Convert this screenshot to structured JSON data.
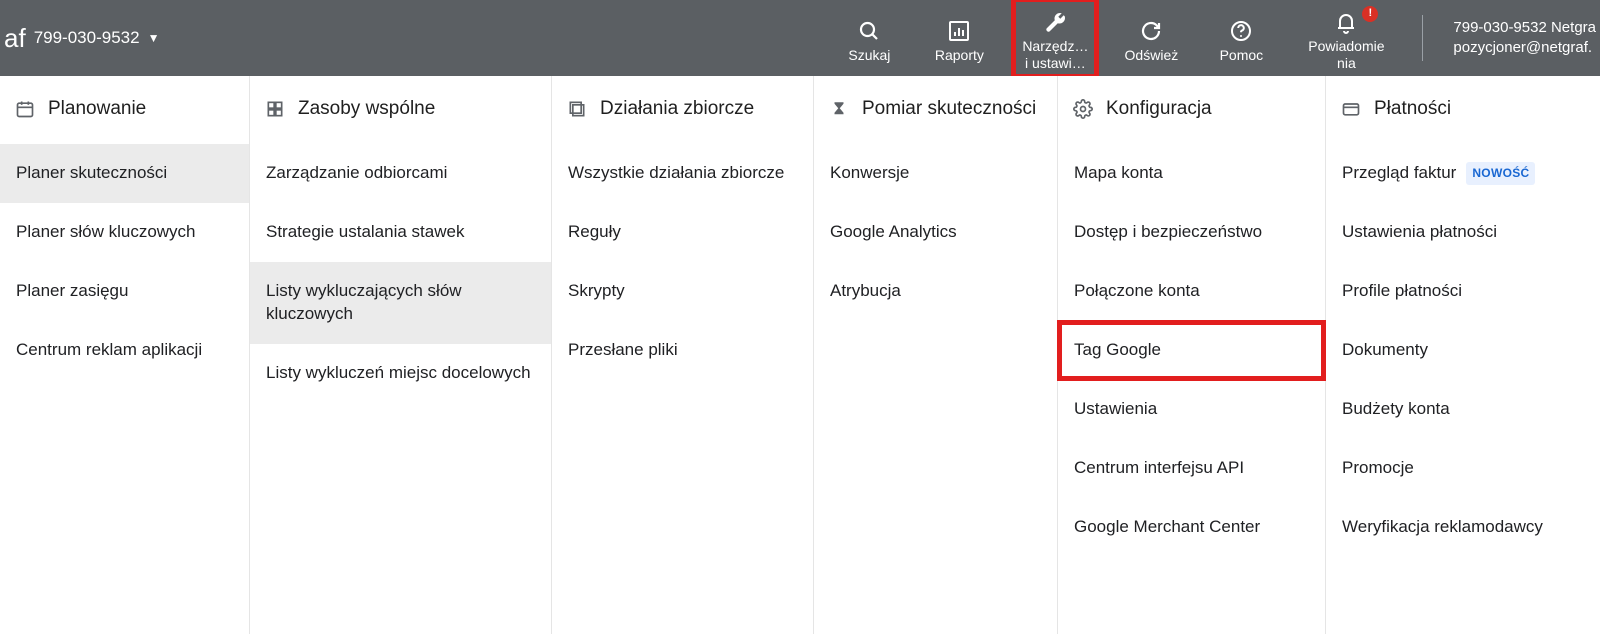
{
  "topbar": {
    "brand": "af",
    "account": "799-030-9532",
    "actions": {
      "search": "Szukaj",
      "reports": "Raporty",
      "tools_l1": "Narzędz…",
      "tools_l2": "i ustawi…",
      "refresh": "Odśwież",
      "help": "Pomoc",
      "notif_l1": "Powiadomie",
      "notif_l2": "nia",
      "notif_badge": "!"
    },
    "account_right_l1": "799-030-9532 Netgra",
    "account_right_l2": "pozycjoner@netgraf."
  },
  "columns": {
    "plan": {
      "title": "Planowanie",
      "items": [
        "Planer skuteczności",
        "Planer słów kluczowych",
        "Planer zasięgu",
        "Centrum reklam aplikacji"
      ]
    },
    "zasoby": {
      "title": "Zasoby wspólne",
      "items": [
        "Zarządzanie odbiorcami",
        "Strategie ustalania stawek",
        "Listy wykluczających słów kluczowych",
        "Listy wykluczeń miejsc docelowych"
      ]
    },
    "dzial": {
      "title": "Działania zbiorcze",
      "items": [
        "Wszystkie działania zbiorcze",
        "Reguły",
        "Skrypty",
        "Przesłane pliki"
      ]
    },
    "pomiar": {
      "title": "Pomiar skuteczności",
      "items": [
        "Konwersje",
        "Google Analytics",
        "Atrybucja"
      ]
    },
    "konfig": {
      "title": "Konfiguracja",
      "items": [
        "Mapa konta",
        "Dostęp i bezpieczeństwo",
        "Połączone konta",
        "Tag Google",
        "Ustawienia",
        "Centrum interfejsu API",
        "Google Merchant Center"
      ]
    },
    "plat": {
      "title": "Płatności",
      "badge_new": "NOWOŚĆ",
      "items": [
        "Przegląd faktur",
        "Ustawienia płatności",
        "Profile płatności",
        "Dokumenty",
        "Budżety konta",
        "Promocje",
        "Weryfikacja reklamodawcy"
      ]
    }
  }
}
